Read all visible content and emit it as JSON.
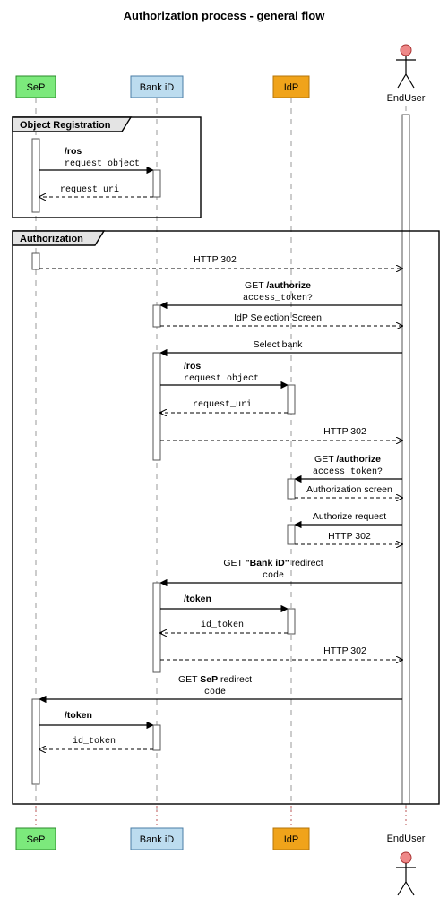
{
  "title": "Authorization process - general flow",
  "participants": {
    "sep": "SeP",
    "bank": "Bank iD",
    "idp": "IdP",
    "enduser": "EndUser"
  },
  "frames": {
    "reg": "Object Registration",
    "auth": "Authorization"
  },
  "messages": {
    "m1": "/ros",
    "m1s": "request object",
    "m2": "request_uri",
    "m3": "HTTP 302",
    "m4": "GET /authorize",
    "m4s": "access_token?",
    "m5": "IdP Selection Screen",
    "m6": "Select bank",
    "m7": "/ros",
    "m7s": "request object",
    "m8": "request_uri",
    "m9": "HTTP 302",
    "m10": "GET /authorize",
    "m10s": "access_token?",
    "m11": "Authorization screen",
    "m12": "Authorize request",
    "m13": "HTTP 302",
    "m14": "GET \"Bank iD\" redirect",
    "m14s": "code",
    "m15": "/token",
    "m16": "id_token",
    "m17": "HTTP 302",
    "m18": "GET SeP redirect",
    "m18s": "code",
    "m19": "/token",
    "m20": "id_token"
  }
}
